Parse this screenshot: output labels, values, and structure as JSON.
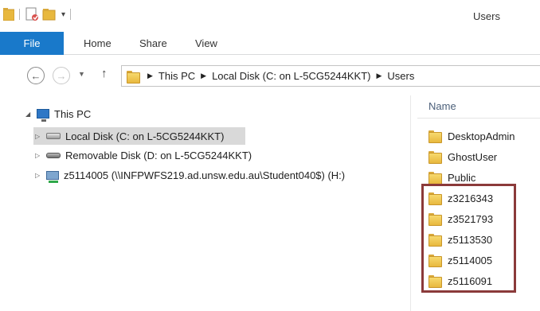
{
  "window": {
    "title": "Users"
  },
  "ribbon": {
    "tabs": [
      {
        "label": "File",
        "active": true
      },
      {
        "label": "Home"
      },
      {
        "label": "Share"
      },
      {
        "label": "View"
      }
    ]
  },
  "address": {
    "crumbs": [
      "This PC",
      "Local Disk (C: on L-5CG5244KKT)",
      "Users"
    ]
  },
  "tree": {
    "root": "This PC",
    "items": [
      {
        "label": "Local Disk (C: on L-5CG5244KKT)",
        "icon": "local-disk-icon",
        "selected": true
      },
      {
        "label": "Removable Disk (D: on L-5CG5244KKT)",
        "icon": "removable-disk-icon"
      },
      {
        "label": "z5114005 (\\\\INFPWFS219.ad.unsw.edu.au\\Student040$) (H:)",
        "icon": "network-drive-icon"
      }
    ]
  },
  "list": {
    "column_header": "Name",
    "items": [
      "DesktopAdmin",
      "GhostUser",
      "Public",
      "z3216343",
      "z3521793",
      "z5113530",
      "z5114005",
      "z5116091"
    ],
    "highlighted": [
      "z3216343",
      "z3521793",
      "z5113530",
      "z5114005",
      "z5116091"
    ]
  },
  "colors": {
    "file_tab": "#1979ca",
    "highlight_border": "#8b3a3a",
    "folder": "#e8b83e"
  }
}
